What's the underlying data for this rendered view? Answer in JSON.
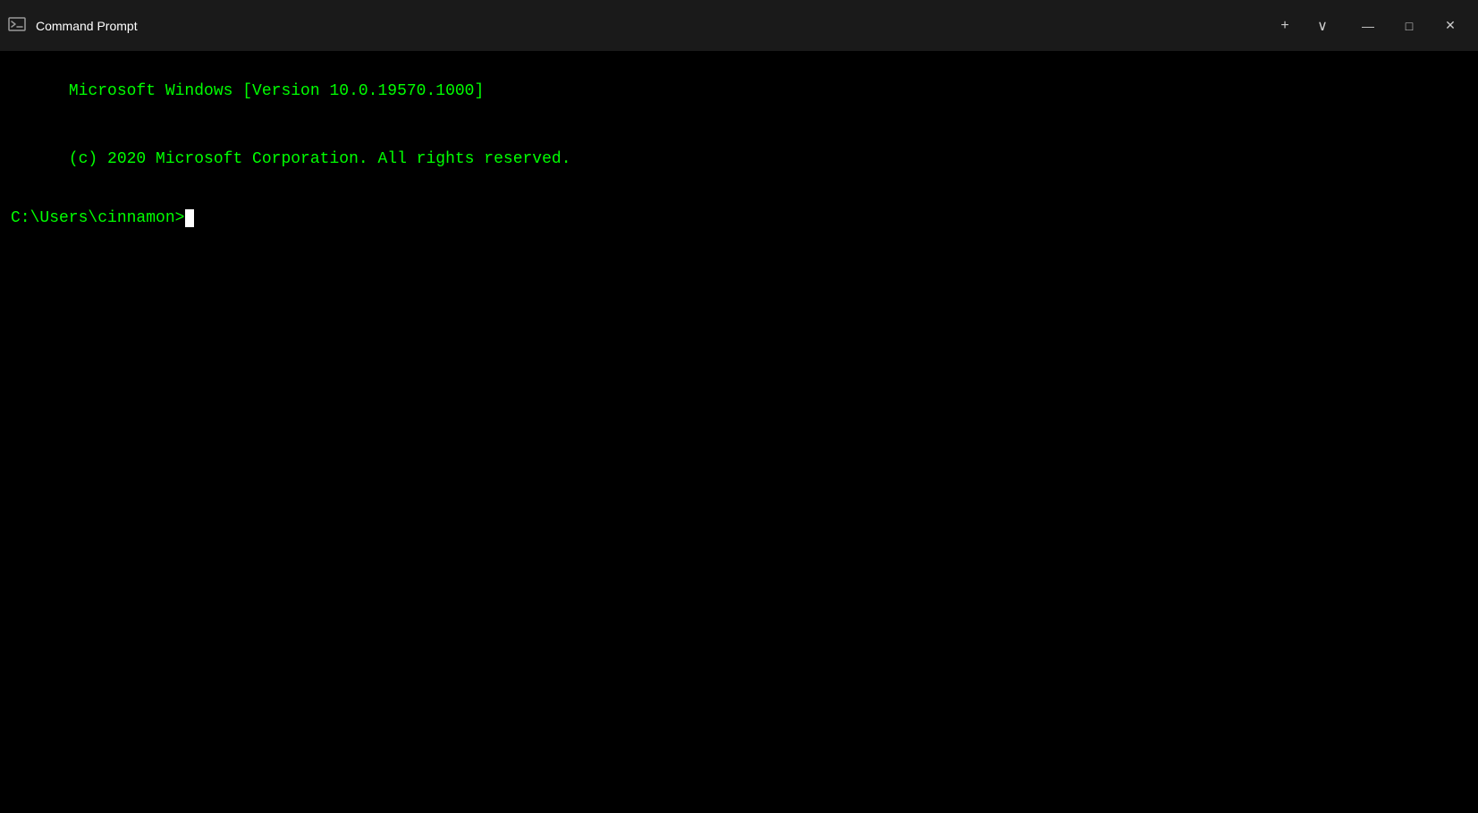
{
  "titlebar": {
    "title": "Command Prompt",
    "icon": "cmd-icon",
    "tab_plus_label": "+",
    "tab_dropdown_label": "∨",
    "minimize_label": "—",
    "maximize_label": "□",
    "close_label": "✕"
  },
  "terminal": {
    "line1": "Microsoft Windows [Version 10.0.19570.1000]",
    "line2": "(c) 2020 Microsoft Corporation. All rights reserved.",
    "prompt": "C:\\Users\\cinnamon>"
  }
}
